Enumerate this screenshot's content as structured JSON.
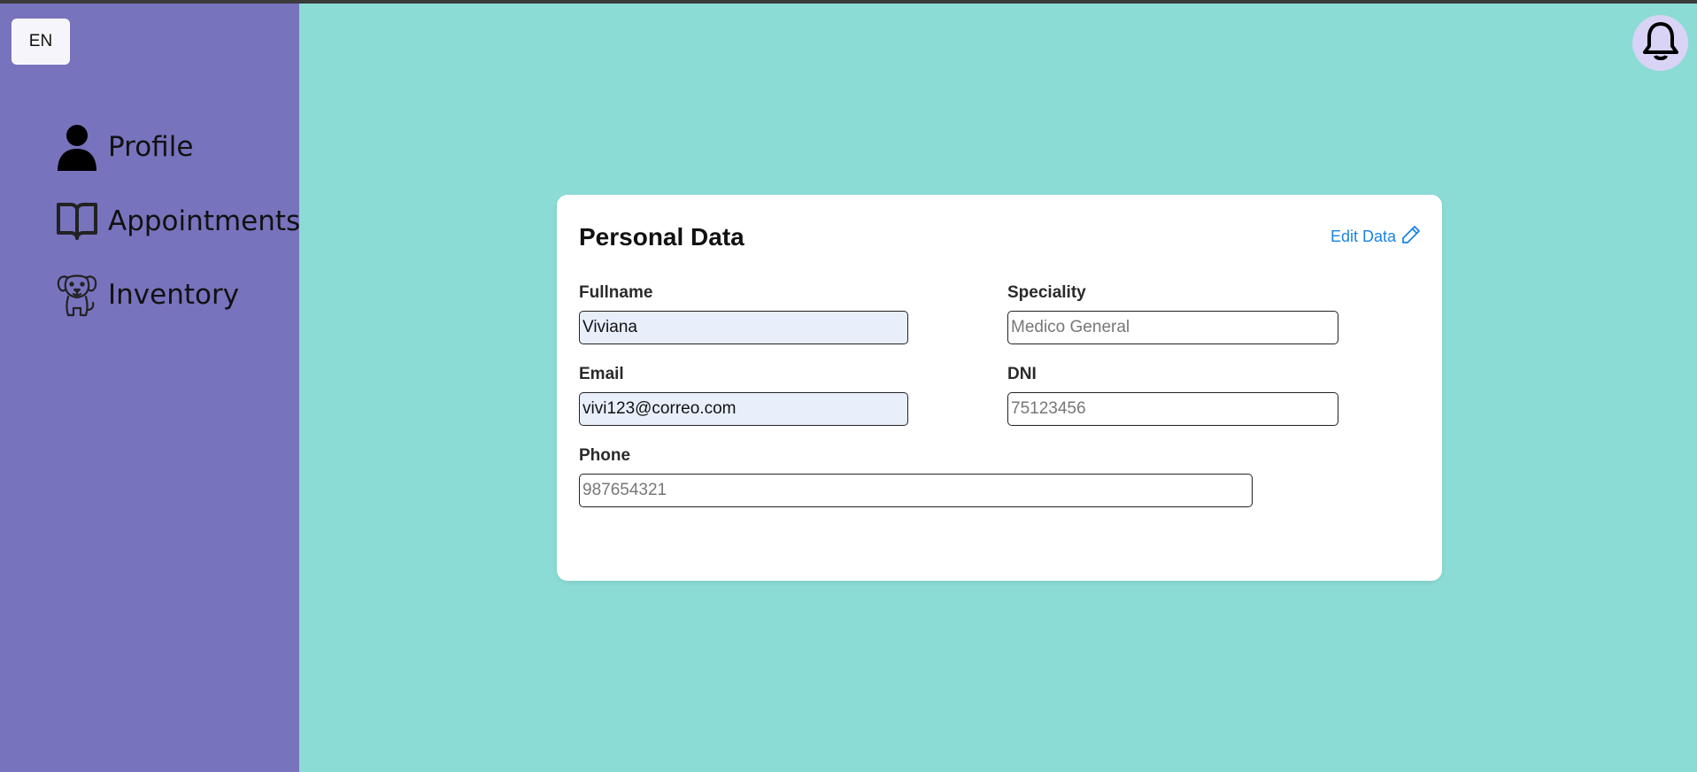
{
  "language": {
    "label": "EN"
  },
  "sidebar": {
    "items": [
      {
        "label": "Profile",
        "icon": "user-icon"
      },
      {
        "label": "Appointments",
        "icon": "book-icon"
      },
      {
        "label": "Inventory",
        "icon": "dog-icon"
      }
    ]
  },
  "header": {
    "notification_icon": "bell-icon"
  },
  "card": {
    "title": "Personal Data",
    "edit_label": "Edit Data",
    "edit_icon": "pencil-icon",
    "fields": {
      "fullname": {
        "label": "Fullname",
        "value": "Viviana"
      },
      "speciality": {
        "label": "Speciality",
        "placeholder": "Medico General"
      },
      "email": {
        "label": "Email",
        "value": "vivi123@correo.com"
      },
      "dni": {
        "label": "DNI",
        "placeholder": "75123456"
      },
      "phone": {
        "label": "Phone",
        "placeholder": "987654321"
      }
    }
  },
  "colors": {
    "sidebar_bg": "#7873bd",
    "main_bg": "#8cdcd6",
    "card_bg": "#ffffff",
    "link": "#1a84e6",
    "bell_bg": "#d9d3f5",
    "autofill_bg": "#e8effb"
  }
}
